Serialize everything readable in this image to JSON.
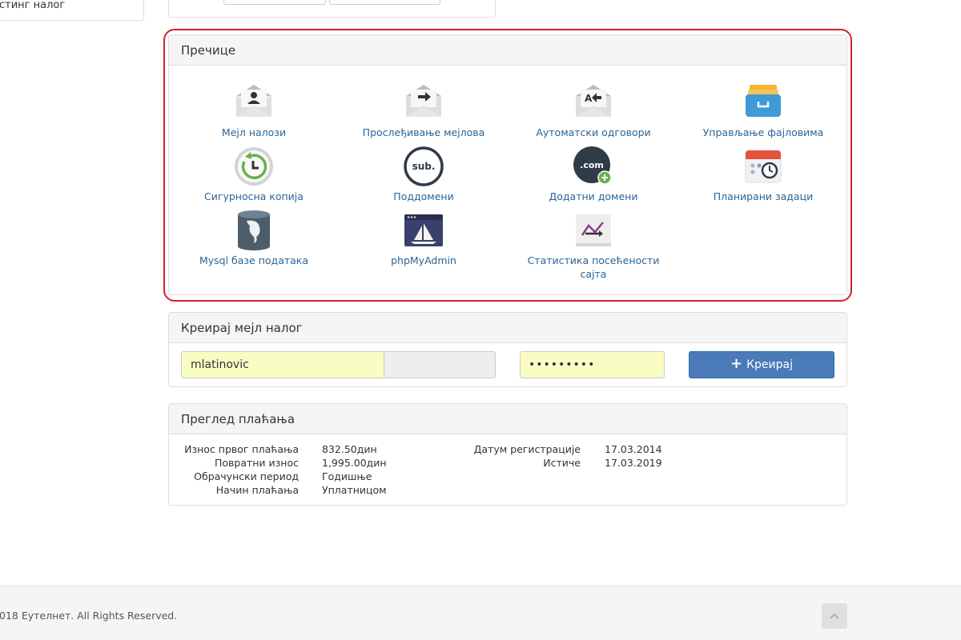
{
  "sidebar": {
    "partial_item_label": "стинг налог"
  },
  "shortcuts": {
    "title": "Пречице",
    "items": [
      {
        "label": "Мејл налози",
        "icon": "mail-accounts-icon"
      },
      {
        "label": "Прослеђивање мејлова",
        "icon": "mail-forwarding-icon"
      },
      {
        "label": "Аутоматски одговори",
        "icon": "autoresponder-icon"
      },
      {
        "label": "Управљање фајловима",
        "icon": "file-manager-icon"
      },
      {
        "label": "Сигурносна копија",
        "icon": "backup-icon"
      },
      {
        "label": "Поддомени",
        "icon": "subdomains-icon"
      },
      {
        "label": "Додатни домени",
        "icon": "addon-domains-icon"
      },
      {
        "label": "Планирани задаци",
        "icon": "cron-jobs-icon"
      },
      {
        "label": "Mysql базе података",
        "icon": "mysql-database-icon"
      },
      {
        "label": "phpMyAdmin",
        "icon": "phpmyadmin-icon"
      },
      {
        "label": "Статистика посећености сајта",
        "icon": "site-statistics-icon"
      }
    ]
  },
  "create_mail": {
    "title": "Креирај мејл налог",
    "username_value": "mlatinovic",
    "password_value": "•••••••••",
    "button_label": "Креирај"
  },
  "payment": {
    "title": "Преглед плаћања",
    "left": [
      {
        "label": "Износ првог плаћања",
        "value": "832.50дин"
      },
      {
        "label": "Повратни износ",
        "value": "1,995.00дин"
      },
      {
        "label": "Обрачунски период",
        "value": "Годишње"
      },
      {
        "label": "Начин плаћања",
        "value": "Уплатницом"
      }
    ],
    "right": [
      {
        "label": "Датум регистрације",
        "value": "17.03.2014"
      },
      {
        "label": "Истиче",
        "value": "17.03.2019"
      }
    ]
  },
  "footer": {
    "copyright": "018 Еутелнет. All Rights Reserved."
  },
  "colors": {
    "link": "#2a6496",
    "primary_button": "#4a7ab8",
    "highlight": "#d0202e",
    "input_autofill": "#fafdc3"
  }
}
